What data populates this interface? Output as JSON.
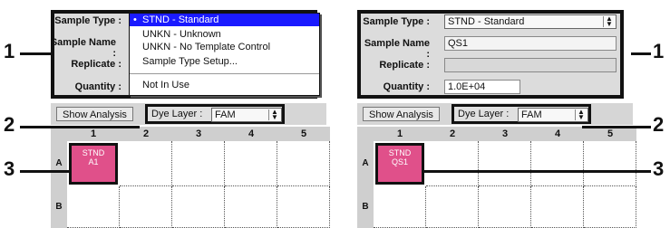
{
  "left_panel": {
    "labels": {
      "sample_type": "Sample Type :",
      "sample_name": "Sample Name :",
      "replicate": "Replicate :",
      "quantity": "Quantity :"
    },
    "dropdown_items": [
      "STND - Standard",
      "UNKN - Unknown",
      "UNKN - No Template Control",
      "Sample Type Setup...",
      "Not In Use"
    ],
    "show_analysis": "Show Analysis",
    "dye_layer_label": "Dye Layer :",
    "dye_layer_value": "FAM",
    "columns": [
      "1",
      "2",
      "3",
      "4",
      "5"
    ],
    "rows": [
      "A",
      "B"
    ],
    "well": {
      "line1": "STND",
      "line2": "A1"
    }
  },
  "right_panel": {
    "labels": {
      "sample_type": "Sample Type :",
      "sample_name": "Sample Name :",
      "replicate": "Replicate :",
      "quantity": "Quantity :"
    },
    "sample_type_value": "STND - Standard",
    "sample_name_value": "QS1",
    "replicate_value": "",
    "quantity_value": "1.0E+04",
    "show_analysis": "Show Analysis",
    "dye_layer_label": "Dye Layer :",
    "dye_layer_value": "FAM",
    "columns": [
      "1",
      "2",
      "3",
      "4",
      "5"
    ],
    "rows": [
      "A",
      "B"
    ],
    "well": {
      "line1": "STND",
      "line2": "QS1"
    }
  },
  "callouts": [
    "1",
    "2",
    "3"
  ],
  "colors": {
    "well_fill": "#e0508a",
    "selected_item": "#1a1aff",
    "panel_bg": "#dcdcdc"
  }
}
